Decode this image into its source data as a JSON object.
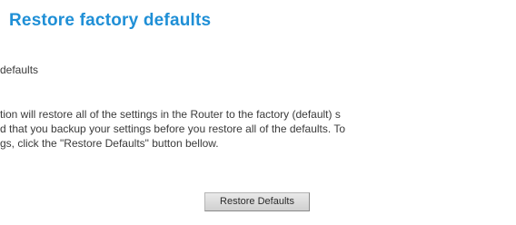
{
  "page": {
    "title": "Restore factory defaults",
    "subheading": "defaults",
    "description_lines": [
      "tion will restore all of the settings in the Router to the factory (default) s",
      "d that you backup your settings before you restore all of the defaults. To",
      "gs, click the \"Restore Defaults\" button bellow."
    ],
    "button_label": "Restore Defaults"
  },
  "colors": {
    "title": "#1f8fd6",
    "text": "#3a3a3a",
    "button_bg": "#dcdcdc"
  }
}
